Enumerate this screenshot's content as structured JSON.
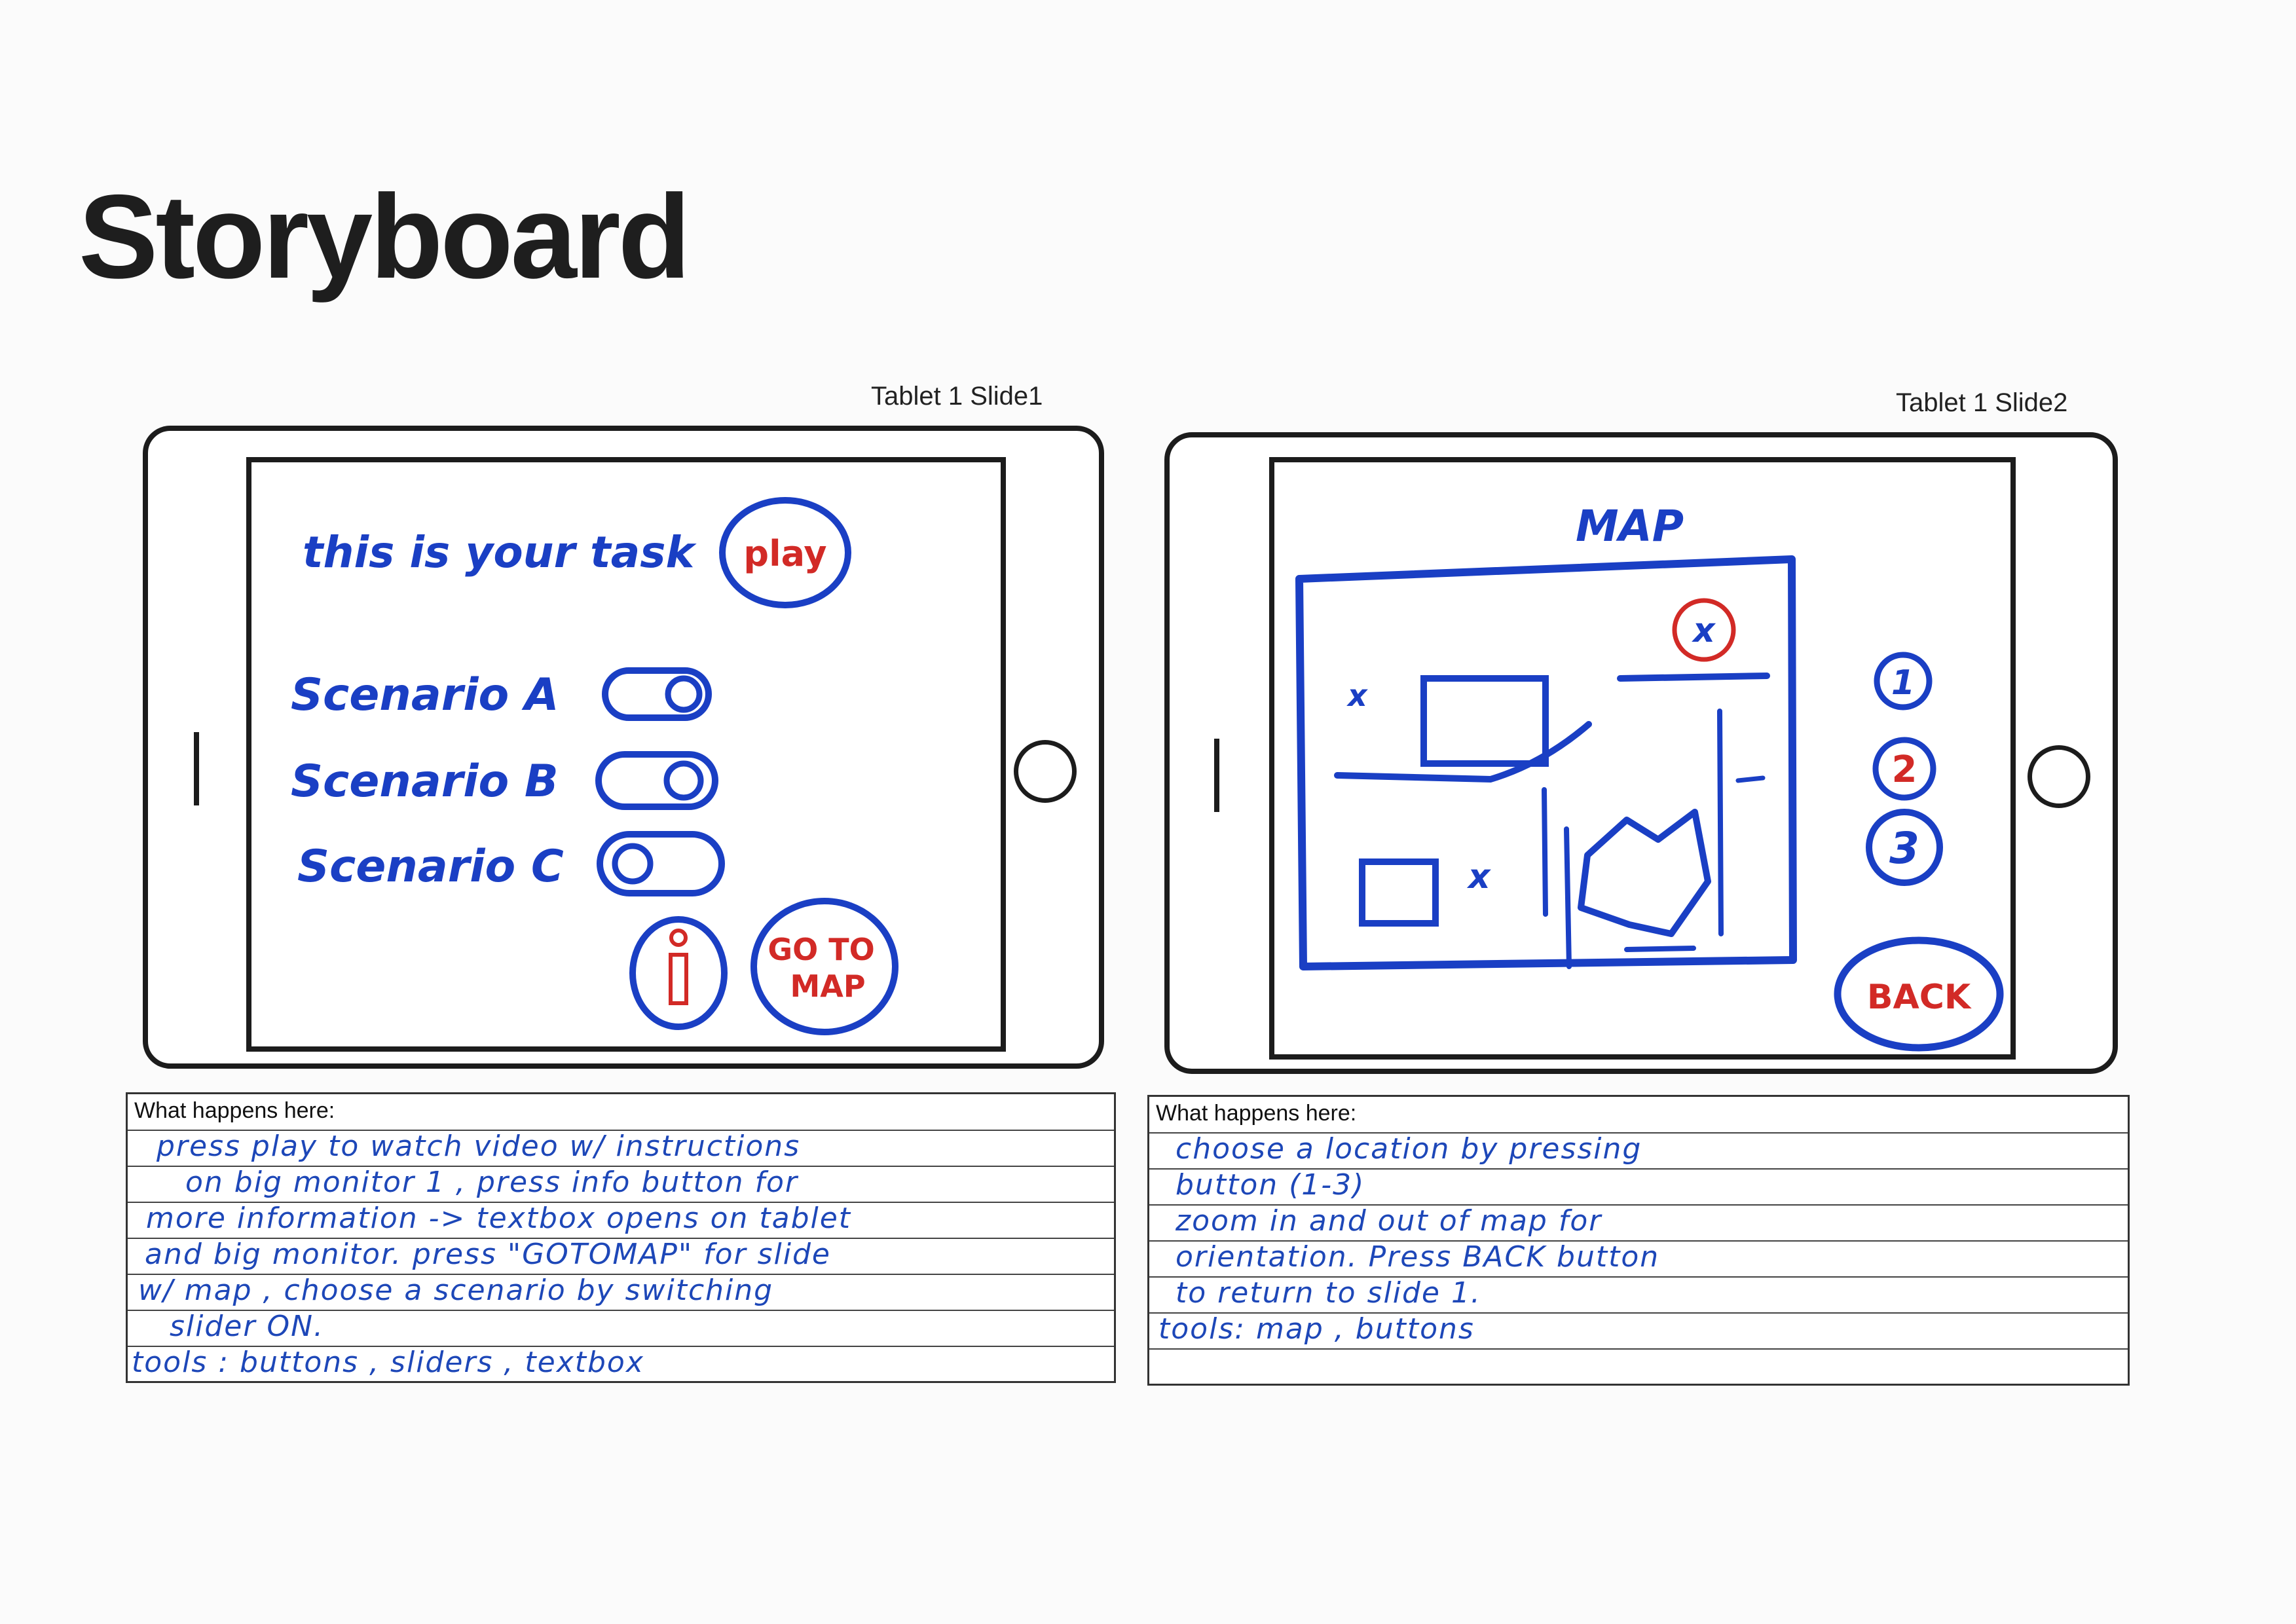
{
  "page": {
    "title": "Storyboard"
  },
  "slides": [
    {
      "label": "Tablet 1 Slide1",
      "screen": {
        "task_text": "this is your task",
        "play_button": "play",
        "scenarios": [
          {
            "label": "Scenario A",
            "toggle": "on"
          },
          {
            "label": "Scenario B",
            "toggle": "on"
          },
          {
            "label": "Scenario C",
            "toggle": "off"
          }
        ],
        "info_button": "i",
        "go_to_map_button": [
          "GO TO",
          "MAP"
        ]
      },
      "notes": {
        "header": "What happens here:",
        "lines": [
          "press play to watch video w/ instructions",
          "on big monitor 1 , press info button for",
          "more information -> textbox opens on tablet",
          "and big monitor. press \"GOTOMAP\" for slide",
          "w/ map , choose a scenario by switching",
          "slider ON.",
          "tools : buttons , sliders , textbox"
        ]
      }
    },
    {
      "label": "Tablet 1 Slide2",
      "screen": {
        "map_title": "MAP",
        "close_marker": "x",
        "location_markers": [
          "x",
          "x"
        ],
        "location_buttons": [
          "1",
          "2",
          "3"
        ],
        "back_button": "BACK"
      },
      "notes": {
        "header": "What happens here:",
        "lines": [
          "choose a location by pressing",
          "button (1-3)",
          "zoom in and out of map for",
          "orientation. Press BACK button",
          "to return to slide 1.",
          "tools: map , buttons"
        ]
      }
    }
  ],
  "colors": {
    "sketch_blue": "#1a3fc4",
    "sketch_red": "#d22a26",
    "outline": "#1c1c1c"
  }
}
